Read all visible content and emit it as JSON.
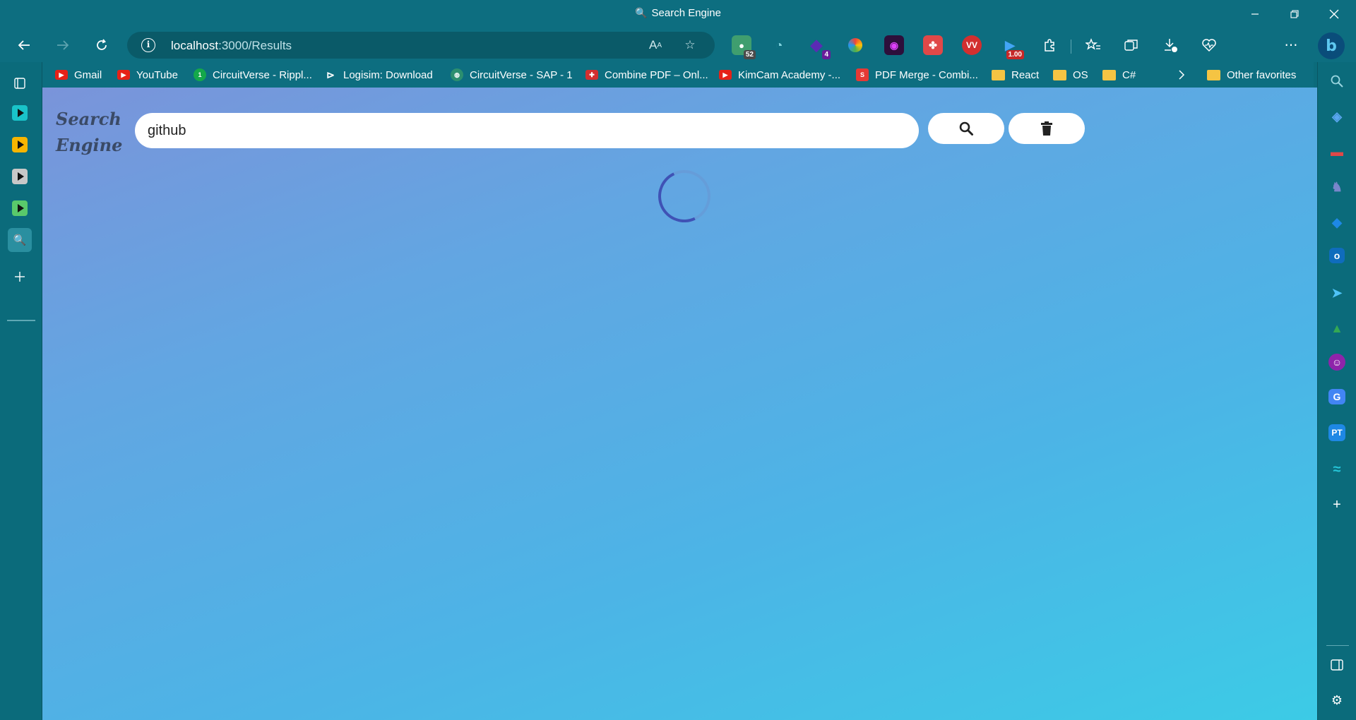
{
  "window": {
    "title": "Search Engine",
    "title_icon": "magnifier-icon",
    "controls": [
      "minimize",
      "restore",
      "close"
    ]
  },
  "toolbar": {
    "address": {
      "host": "localhost",
      "path": ":3000/Results"
    },
    "extensions": [
      {
        "name": "extension-52",
        "badge": "52",
        "color": "#3f9e6f"
      },
      {
        "name": "extension-chat",
        "badge": "",
        "color": "#1f7e8e"
      },
      {
        "name": "extension-4",
        "badge": "4",
        "color": "#5b2bb5"
      },
      {
        "name": "extension-colorful",
        "badge": "",
        "color": "#f0a030"
      },
      {
        "name": "extension-camera",
        "badge": "",
        "color": "#7b1fa2"
      },
      {
        "name": "extension-red-paw",
        "badge": "",
        "color": "#e04848"
      },
      {
        "name": "extension-vw",
        "badge": "",
        "color": "#d32f2f"
      },
      {
        "name": "extension-speed",
        "badge": "1.00",
        "color": "#1565c0"
      }
    ]
  },
  "favorites": [
    {
      "label": "Gmail",
      "icon": "youtube-red"
    },
    {
      "label": "YouTube",
      "icon": "youtube-red"
    },
    {
      "label": "CircuitVerse - Rippl...",
      "icon": "circle-green"
    },
    {
      "label": "Logisim: Download",
      "icon": "logisim"
    },
    {
      "label": "CircuitVerse - SAP - 1",
      "icon": "globe"
    },
    {
      "label": "Combine PDF – Onl...",
      "icon": "pdf"
    },
    {
      "label": "KimCam Academy -...",
      "icon": "youtube-red"
    },
    {
      "label": "PDF Merge - Combi...",
      "icon": "s-red"
    },
    {
      "label": "React",
      "icon": "folder"
    },
    {
      "label": "OS",
      "icon": "folder"
    },
    {
      "label": "C#",
      "icon": "folder"
    }
  ],
  "favorites_other": "Other favorites",
  "vertical_tabs": [
    {
      "name": "tab-video-teal",
      "color": "#19c3c9"
    },
    {
      "name": "tab-video-yellow",
      "color": "#f7b500"
    },
    {
      "name": "tab-video-gray",
      "color": "#c8c8c8"
    },
    {
      "name": "tab-video-green",
      "color": "#59c96b"
    },
    {
      "name": "tab-search-engine",
      "color": "#2a8fa0"
    }
  ],
  "page": {
    "brand_line1": "Search",
    "brand_line2": "Engine",
    "search_value": "github",
    "loading": true
  }
}
